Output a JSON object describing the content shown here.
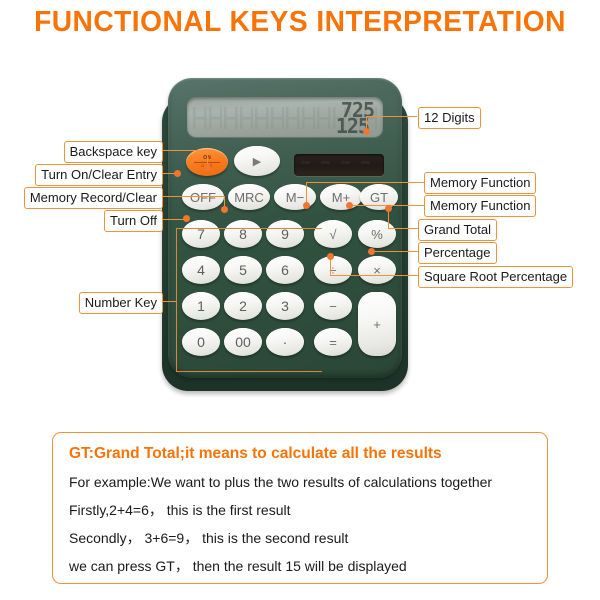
{
  "title": "FUNCTIONAL KEYS INTERPRETATION",
  "colors": {
    "accent_orange": "#f97306",
    "label_border": "#f0923a",
    "body_green": "#3a5a4d",
    "key_white": "#f7f7f5",
    "on_key_orange": "#f97d20"
  },
  "labels_left": [
    {
      "id": "backspace",
      "text": "Backspace key"
    },
    {
      "id": "turn-on-clear-entry",
      "text": "Turn On/Clear Entry"
    },
    {
      "id": "memory-record-clear",
      "text": "Memory Record/Clear"
    },
    {
      "id": "turn-off",
      "text": "Turn Off"
    },
    {
      "id": "number-key",
      "text": "Number Key"
    }
  ],
  "labels_right": [
    {
      "id": "digits",
      "text": "12 Digits"
    },
    {
      "id": "memory-function-1",
      "text": "Memory Function"
    },
    {
      "id": "memory-function-2",
      "text": "Memory Function"
    },
    {
      "id": "grand-total",
      "text": "Grand Total"
    },
    {
      "id": "percentage",
      "text": "Percentage"
    },
    {
      "id": "square-root-percentage",
      "text": "Square Root Percentage"
    }
  ],
  "calculator": {
    "display": {
      "digits_line1": "725",
      "digits_line2": "125"
    },
    "on_key": {
      "line1": "ON",
      "line2": "C CE"
    },
    "function_keys": [
      {
        "id": "backspace",
        "label": "▶"
      },
      {
        "id": "off",
        "label": "OFF"
      },
      {
        "id": "mrc",
        "label": "MRC"
      },
      {
        "id": "m-minus",
        "label": "M−"
      },
      {
        "id": "m-plus",
        "label": "M+"
      },
      {
        "id": "gt",
        "label": "GT"
      }
    ],
    "keypad": [
      {
        "id": "7",
        "label": "7"
      },
      {
        "id": "8",
        "label": "8"
      },
      {
        "id": "9",
        "label": "9"
      },
      {
        "id": "sqrt",
        "label": "√"
      },
      {
        "id": "percent",
        "label": "%"
      },
      {
        "id": "4",
        "label": "4"
      },
      {
        "id": "5",
        "label": "5"
      },
      {
        "id": "6",
        "label": "6"
      },
      {
        "id": "divide",
        "label": "÷"
      },
      {
        "id": "multiply",
        "label": "×"
      },
      {
        "id": "1",
        "label": "1"
      },
      {
        "id": "2",
        "label": "2"
      },
      {
        "id": "3",
        "label": "3"
      },
      {
        "id": "minus",
        "label": "−"
      },
      {
        "id": "plus",
        "label": "+"
      },
      {
        "id": "0",
        "label": "0"
      },
      {
        "id": "00",
        "label": "00"
      },
      {
        "id": "dot",
        "label": "·"
      },
      {
        "id": "equals",
        "label": "="
      }
    ]
  },
  "note": {
    "heading": "GT:Grand Total;it means to calculate all the results",
    "lines": [
      "For example:We want to plus the two  results of calculations together",
      "Firstly,2+4=6， this is the first result",
      "Secondly， 3+6=9， this is the second result",
      "we can press GT， then the result 15 will be displayed"
    ]
  }
}
